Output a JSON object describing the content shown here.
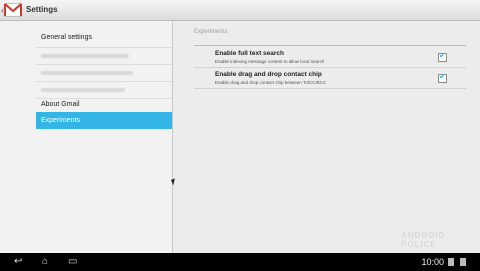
{
  "app": {
    "title": "Settings"
  },
  "left": {
    "items": [
      {
        "label": "General settings"
      },
      {
        "label": "About Gmail"
      },
      {
        "label": "Experiments"
      }
    ]
  },
  "right": {
    "section": "Experiments",
    "prefs": [
      {
        "title": "Enable full text search",
        "summary": "Enable indexing message content to allow local search",
        "checked": true
      },
      {
        "title": "Enable drag and drop contact chip",
        "summary": "Enable drag and drop contact chip between To/CC/BCC",
        "checked": true
      }
    ]
  },
  "status": {
    "time": "10:00"
  },
  "watermark": "ANDROID POLICE",
  "colors": {
    "accent": "#33b5e5",
    "navbar": "#000000"
  }
}
